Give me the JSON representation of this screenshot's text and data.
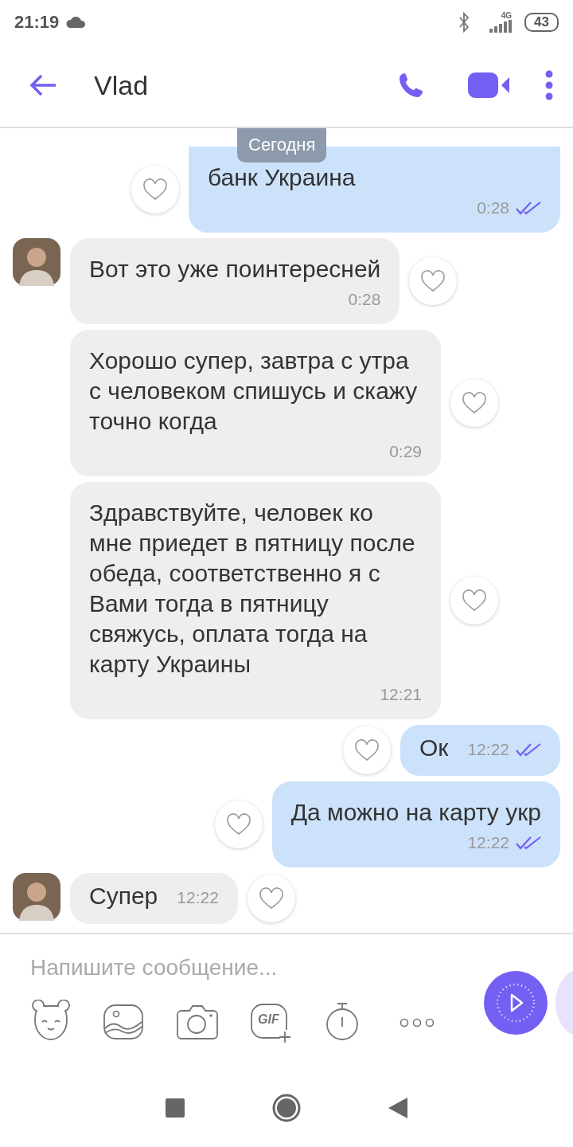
{
  "status_bar": {
    "time": "21:19",
    "network": "4G",
    "battery": "43"
  },
  "header": {
    "title": "Vlad"
  },
  "date_pill": "Сегодня",
  "messages": [
    {
      "outgoing": true,
      "kind": "block",
      "text": "банк Украина",
      "time": "0:28",
      "read": true
    },
    {
      "outgoing": false,
      "kind": "block",
      "text": "Вот это уже поинтересней",
      "time": "0:28",
      "avatar": true
    },
    {
      "outgoing": false,
      "kind": "block",
      "text": "Хорошо супер, завтра с утра с человеком спишусь и скажу точно когда",
      "time": "0:29",
      "avatar": false
    },
    {
      "outgoing": false,
      "kind": "block",
      "text": "Здравствуйте, человек ко мне приедет в пятницу после обеда, соответственно я с Вами тогда в пятницу свяжусь, оплата тогда на карту Украины",
      "time": "12:21",
      "avatar": false
    },
    {
      "outgoing": true,
      "kind": "inline",
      "text": "Ок",
      "time": "12:22",
      "read": true
    },
    {
      "outgoing": true,
      "kind": "block",
      "text": "Да можно на карту укр",
      "time": "12:22",
      "read": true
    },
    {
      "outgoing": false,
      "kind": "inline",
      "text": "Супер",
      "time": "12:22",
      "avatar": true
    }
  ],
  "composer": {
    "placeholder": "Напишите сообщение..."
  },
  "toolbar": [
    {
      "kind": "sticker"
    },
    {
      "kind": "gallery"
    },
    {
      "kind": "camera"
    },
    {
      "kind": "gif",
      "label": "GIF"
    },
    {
      "kind": "timer"
    },
    {
      "kind": "more"
    }
  ]
}
